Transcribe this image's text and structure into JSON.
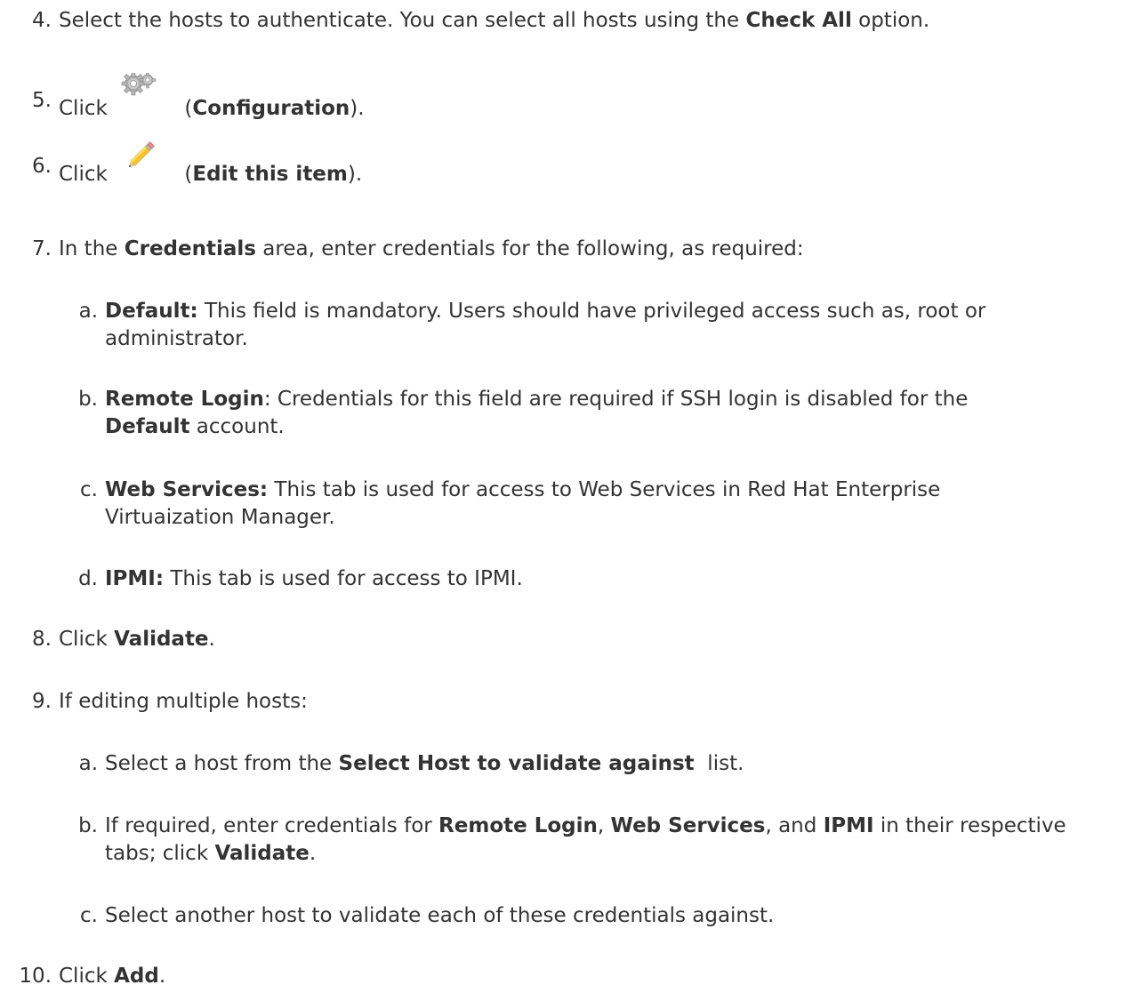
{
  "steps": [
    {
      "num": "4.",
      "parts": [
        {
          "t": "Select the hosts to authenticate. You can select all hosts using the "
        },
        {
          "b": "Check All"
        },
        {
          "t": " option."
        }
      ]
    },
    {
      "num": "5.",
      "pre": "Click ",
      "icon": "gear-icon",
      "post_open": " (",
      "post_bold": "Configuration",
      "post_close": ")."
    },
    {
      "num": "6.",
      "pre": "Click ",
      "icon": "pencil-icon",
      "post_open": " (",
      "post_bold": "Edit this item",
      "post_close": ")."
    },
    {
      "num": "7.",
      "parts": [
        {
          "t": "In the "
        },
        {
          "b": "Credentials"
        },
        {
          "t": " area, enter credentials for the following, as required:"
        }
      ]
    },
    {
      "num": "a.",
      "sub": true,
      "lines": [
        [
          {
            "b": "Default:"
          },
          {
            "t": " This field is mandatory. Users should have privileged access such as, root or"
          }
        ],
        [
          {
            "t": "administrator."
          }
        ]
      ]
    },
    {
      "num": "b.",
      "sub": true,
      "lines": [
        [
          {
            "b": "Remote Login"
          },
          {
            "t": ": Credentials for this field are required if SSH login is disabled for the"
          }
        ],
        [
          {
            "b": "Default"
          },
          {
            "t": " account."
          }
        ]
      ]
    },
    {
      "num": "c.",
      "sub": true,
      "lines": [
        [
          {
            "b": "Web Services:"
          },
          {
            "t": " This tab is used for access to Web Services in Red Hat Enterprise"
          }
        ],
        [
          {
            "t": "Virtuaization Manager."
          }
        ]
      ]
    },
    {
      "num": "d.",
      "sub": true,
      "lines": [
        [
          {
            "b": "IPMI:"
          },
          {
            "t": " This tab is used for access to IPMI."
          }
        ]
      ]
    },
    {
      "num": "8.",
      "parts": [
        {
          "t": "Click "
        },
        {
          "b": "Validate"
        },
        {
          "t": "."
        }
      ]
    },
    {
      "num": "9.",
      "parts": [
        {
          "t": "If editing multiple hosts:"
        }
      ]
    },
    {
      "num": "a.",
      "sub": true,
      "lines": [
        [
          {
            "t": "Select a host from the "
          },
          {
            "b": "Select Host to validate against"
          },
          {
            "t": "  list."
          }
        ]
      ]
    },
    {
      "num": "b.",
      "sub": true,
      "lines": [
        [
          {
            "t": "If required, enter credentials for "
          },
          {
            "b": "Remote Login"
          },
          {
            "t": ", "
          },
          {
            "b": "Web Services"
          },
          {
            "t": ", and "
          },
          {
            "b": "IPMI"
          },
          {
            "t": " in their respective"
          }
        ],
        [
          {
            "t": "tabs; click "
          },
          {
            "b": "Validate"
          },
          {
            "t": "."
          }
        ]
      ]
    },
    {
      "num": "c.",
      "sub": true,
      "lines": [
        [
          {
            "t": "Select another host to validate each of these credentials against."
          }
        ]
      ]
    },
    {
      "num": "10.",
      "parts": [
        {
          "t": "Click "
        },
        {
          "b": "Add"
        },
        {
          "t": "."
        }
      ]
    }
  ]
}
